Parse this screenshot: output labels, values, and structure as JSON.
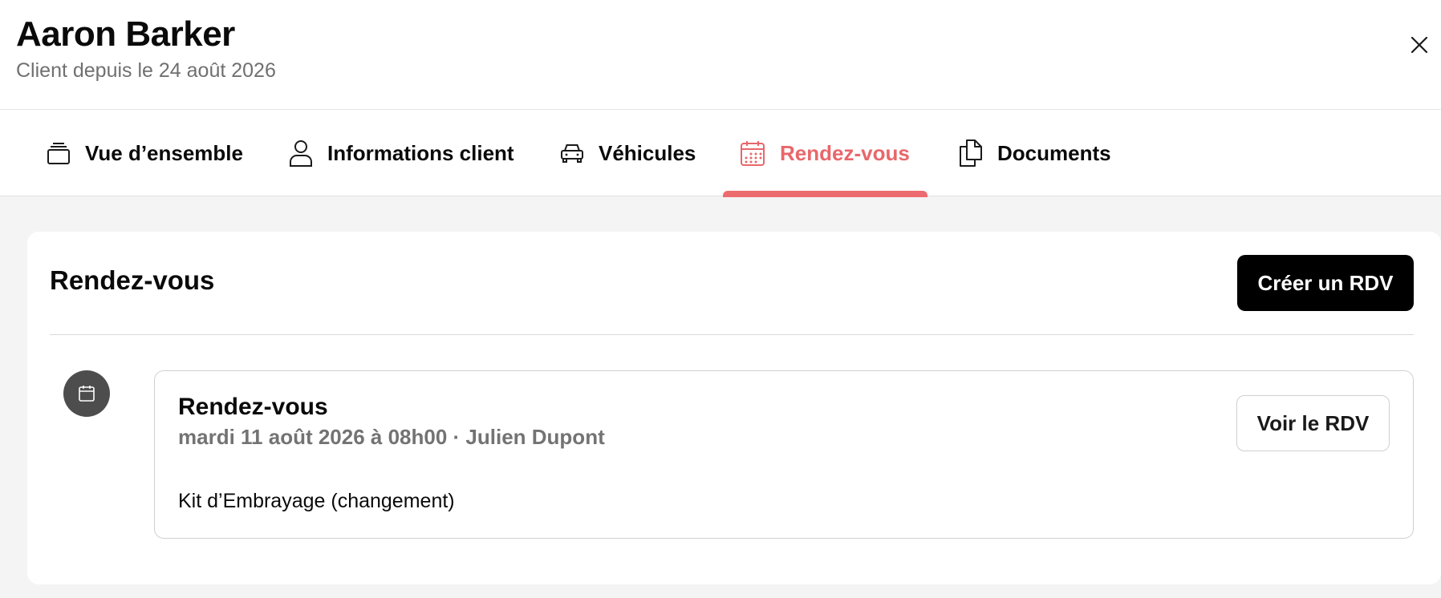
{
  "header": {
    "client_name": "Aaron Barker",
    "client_since": "Client depuis le 24 août 2026",
    "close_icon": "close-icon"
  },
  "tabs": [
    {
      "label": "Vue d’ensemble",
      "icon": "stack-icon",
      "active": false
    },
    {
      "label": "Informations client",
      "icon": "user-icon",
      "active": false
    },
    {
      "label": "Véhicules",
      "icon": "car-icon",
      "active": false
    },
    {
      "label": "Rendez-vous",
      "icon": "calendar-icon",
      "active": true
    },
    {
      "label": "Documents",
      "icon": "documents-icon",
      "active": false
    }
  ],
  "section": {
    "title": "Rendez-vous",
    "create_button": "Créer un RDV"
  },
  "appointments": [
    {
      "title": "Rendez-vous",
      "meta": "mardi 11 août 2026 à 08h00 · Julien Dupont",
      "description": "Kit d’Embrayage (changement)",
      "view_button": "Voir le RDV",
      "icon": "calendar-icon"
    }
  ],
  "colors": {
    "accent": "#ec6b6f",
    "primary_button": "#000000",
    "muted_text": "#737373"
  }
}
